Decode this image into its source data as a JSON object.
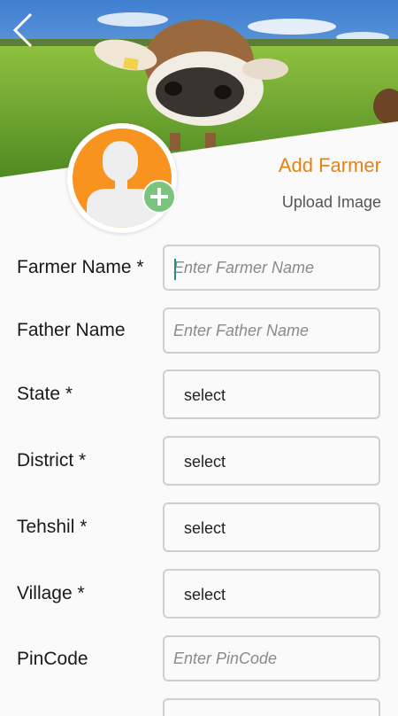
{
  "header": {
    "title": "Add Farmer",
    "upload_label": "Upload Image"
  },
  "form": {
    "farmer_name": {
      "label": "Farmer Name *",
      "placeholder": "Enter Farmer Name",
      "value": ""
    },
    "father_name": {
      "label": "Father Name",
      "placeholder": "Enter Father Name",
      "value": ""
    },
    "state": {
      "label": "State *",
      "value": "select"
    },
    "district": {
      "label": "District *",
      "value": "select"
    },
    "tehshil": {
      "label": "Tehshil *",
      "value": "select"
    },
    "village": {
      "label": "Village *",
      "value": "select"
    },
    "pincode": {
      "label": "PinCode",
      "placeholder": "Enter PinCode",
      "value": ""
    }
  },
  "icons": {
    "back": "chevron-left-icon",
    "avatar": "person-placeholder-icon",
    "add": "plus-icon"
  },
  "colors": {
    "accent": "#e8820f",
    "avatar_bg": "#f7931e",
    "add_badge": "#7ac47f",
    "field_border": "#cfcfcf"
  }
}
